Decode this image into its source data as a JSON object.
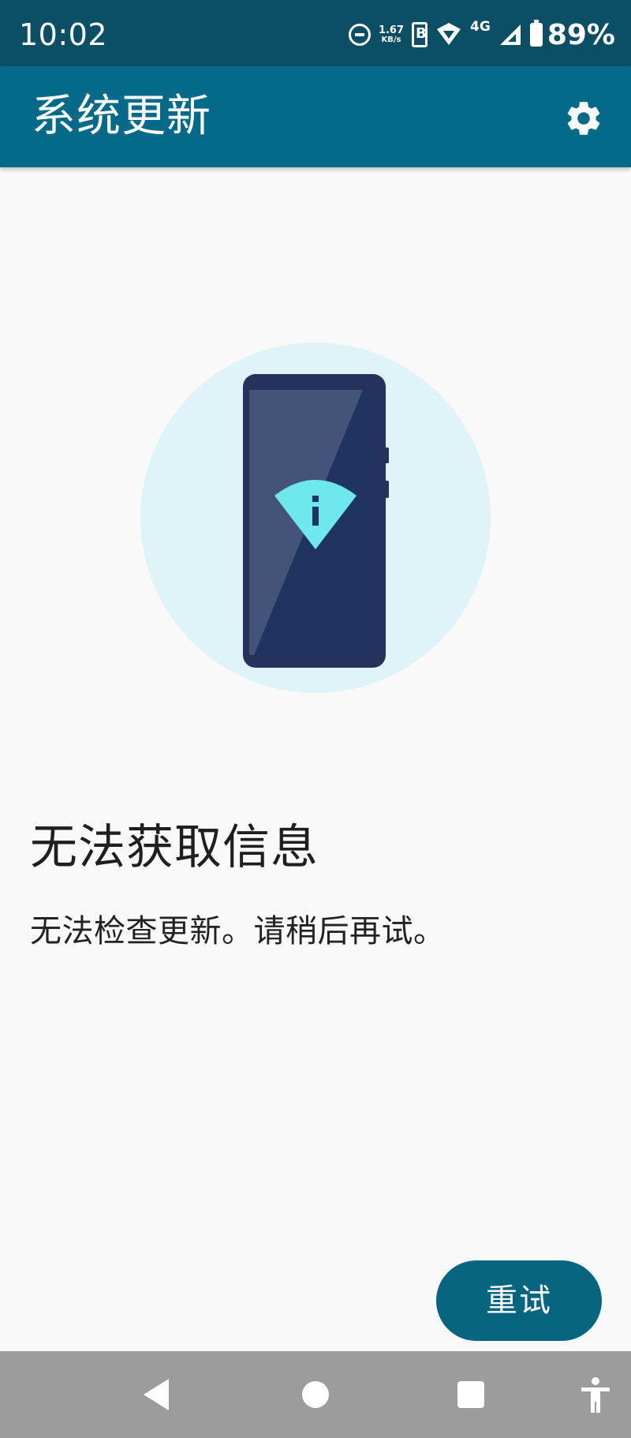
{
  "status_bar": {
    "time": "10:02",
    "net_speed_value": "1.67",
    "net_speed_unit": "KB/s",
    "network_type": "4G",
    "battery": "89%",
    "icons": [
      "do-not-disturb-icon",
      "sim-icon",
      "wifi-icon",
      "cell-signal-icon",
      "battery-icon"
    ]
  },
  "app_bar": {
    "title": "系统更新",
    "settings_icon": "gear-icon"
  },
  "illustration": {
    "icon": "phone-wifi-info-illustration",
    "colors": {
      "circle": "#dff4f8",
      "phone": "#1f3461",
      "accent": "#6ee8ec"
    }
  },
  "content": {
    "title": "无法获取信息",
    "message": "无法检查更新。请稍后再试。"
  },
  "actions": {
    "retry_label": "重试"
  },
  "nav_bar": {
    "icons": [
      "back-icon",
      "home-icon",
      "recents-icon",
      "accessibility-icon"
    ]
  },
  "colors": {
    "status_bar": "#0a4f63",
    "app_bar": "#046a89",
    "background": "#f9f9f9",
    "button": "#06667f",
    "nav_bar": "#9c9c9c"
  }
}
